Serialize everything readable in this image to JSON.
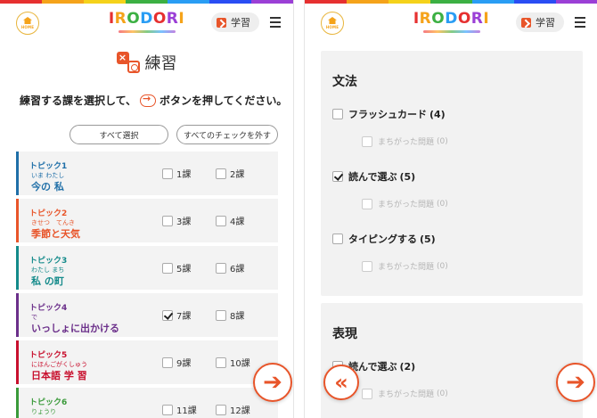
{
  "colors": {
    "accent": "#e8552a",
    "stripe": [
      "#e63030",
      "#f5a31a",
      "#f5d21a",
      "#3cb043",
      "#2a9df4",
      "#2a4df4",
      "#9b3fd6"
    ]
  },
  "header": {
    "home_label": "HOME",
    "logo_letters": [
      "I",
      "R",
      "O",
      "D",
      "O",
      "R",
      "I"
    ],
    "logo_colors": [
      "#e63030",
      "#f5a31a",
      "#3cb043",
      "#2a9df4",
      "#e63030",
      "#9b3fd6",
      "#f5a31a"
    ],
    "study_label": "学習"
  },
  "left": {
    "title": "練習",
    "instruction_pre": "練習する課を選択して、",
    "instruction_post": "ボタンを押してください。",
    "select_all": "すべて選択",
    "clear_all": "すべてのチェックを外す",
    "topics": [
      {
        "label": "トピック1",
        "ruby": "いま わたし",
        "name": "今の 私",
        "color": "#1f6fa8",
        "name_color": "#1f6fa8",
        "lessons": [
          {
            "label": "1課",
            "checked": false
          },
          {
            "label": "2課",
            "checked": false
          }
        ]
      },
      {
        "label": "トピック2",
        "ruby": "きせつ　てんき",
        "name": "季節と天気",
        "color": "#e8552a",
        "name_color": "#e8552a",
        "lessons": [
          {
            "label": "3課",
            "checked": false
          },
          {
            "label": "4課",
            "checked": false
          }
        ]
      },
      {
        "label": "トピック3",
        "ruby": "わたし まち",
        "name": "私 の町",
        "color": "#138a8a",
        "name_color": "#138a8a",
        "lessons": [
          {
            "label": "5課",
            "checked": false
          },
          {
            "label": "6課",
            "checked": false
          }
        ]
      },
      {
        "label": "トピック4",
        "ruby": "で",
        "name": "いっしょに出かける",
        "color": "#6b2f8a",
        "name_color": "#6b2f8a",
        "lessons": [
          {
            "label": "7課",
            "checked": true
          },
          {
            "label": "8課",
            "checked": false
          }
        ]
      },
      {
        "label": "トピック5",
        "ruby": "にほんごがくしゅう",
        "name": "日本語 学 習",
        "color": "#c8102e",
        "name_color": "#c8102e",
        "lessons": [
          {
            "label": "9課",
            "checked": false
          },
          {
            "label": "10課",
            "checked": false
          }
        ]
      },
      {
        "label": "トピック6",
        "ruby": "りょうり",
        "name": "",
        "color": "#3a9a3a",
        "name_color": "#3a9a3a",
        "lessons": [
          {
            "label": "11課",
            "checked": false
          },
          {
            "label": "12課",
            "checked": false
          }
        ]
      }
    ]
  },
  "right": {
    "grammar_title": "文法",
    "grammar_options": [
      {
        "label": "フラッシュカード",
        "count": "(4)",
        "checked": false,
        "sub_label": "まちがった問題",
        "sub_count": "(0)"
      },
      {
        "label": "読んで選ぶ",
        "count": "(5)",
        "checked": true,
        "sub_label": "まちがった問題",
        "sub_count": "(0)"
      },
      {
        "label": "タイピングする",
        "count": "(5)",
        "checked": false,
        "sub_label": "まちがった問題",
        "sub_count": "(0)"
      }
    ],
    "expr_title": "表現",
    "expr_options": [
      {
        "label": "読んで選ぶ",
        "count": "(2)",
        "checked": false,
        "sub_label": "まちがった問題",
        "sub_count": "(0)"
      }
    ]
  },
  "nav": {
    "next_glyph": "➔",
    "back_glyph": "«"
  }
}
